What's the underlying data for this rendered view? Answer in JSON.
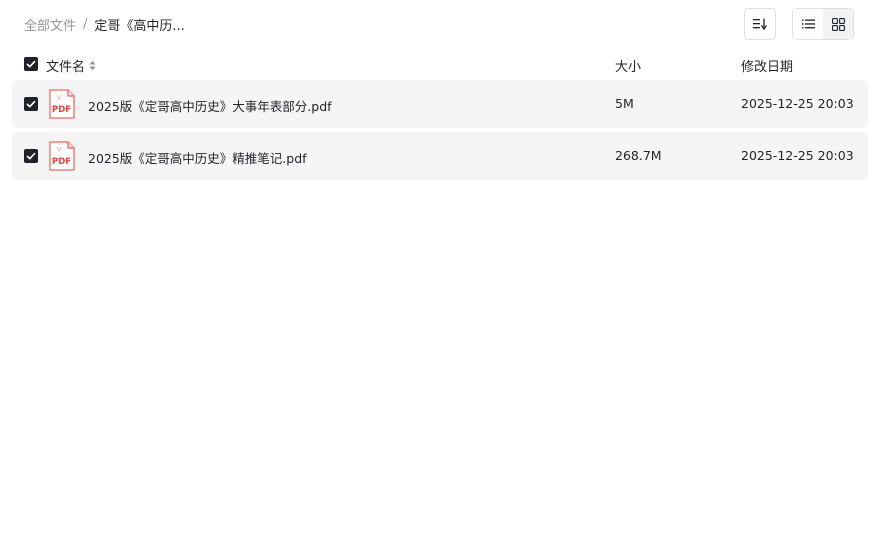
{
  "breadcrumb": {
    "root": "全部文件",
    "separator": "/",
    "current": "定哥《高中历..."
  },
  "toolbar": {
    "sort_icon": "sort-descending-icon",
    "list_view_icon": "list-view-icon",
    "grid_view_icon": "grid-view-icon",
    "active_view": "list"
  },
  "table": {
    "select_all_checked": true,
    "columns": {
      "name": "文件名",
      "size": "大小",
      "date": "修改日期"
    },
    "rows": [
      {
        "name": "2025版《定哥高中历史》大事年表部分.pdf",
        "size": "5M",
        "date": "2025-12-25 20:03",
        "checked": true,
        "icon": "pdf-file-icon"
      },
      {
        "name": "2025版《定哥高中历史》精推笔记.pdf",
        "size": "268.7M",
        "date": "2025-12-25 20:03",
        "checked": true,
        "icon": "pdf-file-icon"
      }
    ]
  },
  "colors": {
    "text": "#1f2329",
    "muted": "#8f959e",
    "row_bg": "#f5f5f5",
    "border": "#dee0e3",
    "pdf_red": "#e8423b"
  }
}
